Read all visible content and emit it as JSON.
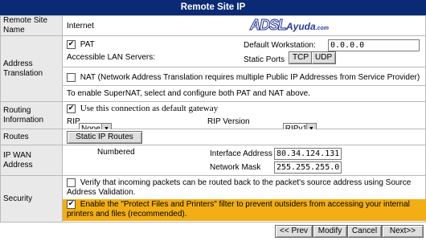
{
  "title": "Remote Site IP",
  "logo": {
    "part1": "ADSL",
    "part2": "Ayuda",
    "part3": ".com"
  },
  "remote_site": {
    "label": "Remote Site Name",
    "value": "Internet"
  },
  "address_translation": {
    "label": "Address Translation",
    "pat": {
      "label": "PAT",
      "checked": true
    },
    "default_workstation": {
      "label": "Default Workstation:",
      "value": "0.0.0.0"
    },
    "accessible_lan": "Accessible LAN Servers:",
    "static_ports": {
      "label": "Static Ports",
      "tcp": "TCP",
      "udp": "UDP"
    },
    "nat": {
      "label": "NAT (Network Address Translation requires multiple Public IP Addresses from Service Provider)",
      "checked": false
    },
    "supernat_note": "To enable SuperNAT, select and configure both PAT and NAT above."
  },
  "routing": {
    "label": "Routing Information",
    "default_gateway": {
      "label": "Use this connection as default gateway",
      "checked": true
    },
    "rip": {
      "label": "RIP",
      "value": "None"
    },
    "rip_version": {
      "label": "RIP Version",
      "value": "RIPv1"
    }
  },
  "routes": {
    "label": "Routes",
    "button": "Static IP Routes"
  },
  "ip_wan": {
    "label": "IP WAN Address",
    "mode": "Numbered",
    "interface_address": {
      "label": "Interface Address",
      "value": "80.34.124.131"
    },
    "network_mask": {
      "label": "Network Mask",
      "value": "255.255.255.0"
    }
  },
  "security": {
    "label": "Security",
    "verify": {
      "label": "Verify that incoming packets can be routed back to the packet's source address using Source Address Validation.",
      "checked": false
    },
    "protect": {
      "label": "Enable the \"Protect Files and Printers\" filter to prevent outsiders from accessing your internal printers and files (recommended).",
      "checked": true
    }
  },
  "nav": {
    "prev": "<< Prev",
    "modify": "Modify",
    "cancel": "Cancel",
    "next": "Next>>"
  },
  "colors": {
    "title_bg": "#0a2a75",
    "label_bg": "#e9e9e9",
    "highlight": "#f2ae15"
  }
}
